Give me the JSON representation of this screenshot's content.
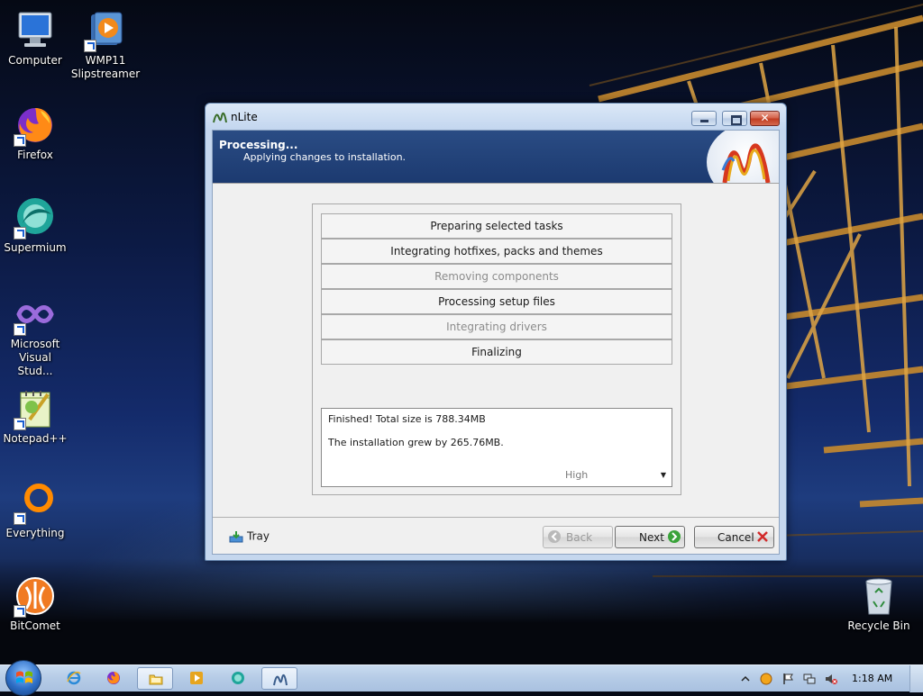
{
  "desktop": {
    "icons": [
      {
        "label": "Computer",
        "icon": "computer-icon"
      },
      {
        "label": "WMP11 Slipstreamer",
        "icon": "wmp-icon"
      },
      {
        "label": "Firefox",
        "icon": "firefox-icon"
      },
      {
        "label": "Supermium",
        "icon": "supermium-icon"
      },
      {
        "label": "Microsoft Visual Stud...",
        "icon": "visual-studio-icon"
      },
      {
        "label": "Notepad++",
        "icon": "notepadpp-icon"
      },
      {
        "label": "Everything",
        "icon": "everything-icon"
      },
      {
        "label": "BitComet",
        "icon": "bitcomet-icon"
      },
      {
        "label": "Recycle Bin",
        "icon": "recycle-bin-icon"
      }
    ]
  },
  "window": {
    "title": "nLite",
    "header": {
      "title": "Processing...",
      "subtitle": "Applying changes to installation."
    },
    "tasks": [
      {
        "label": "Preparing selected tasks",
        "state": "done"
      },
      {
        "label": "Integrating hotfixes, packs and themes",
        "state": "done"
      },
      {
        "label": "Removing components",
        "state": "skipped"
      },
      {
        "label": "Processing setup files",
        "state": "done"
      },
      {
        "label": "Integrating drivers",
        "state": "skipped"
      },
      {
        "label": "Finalizing",
        "state": "done"
      }
    ],
    "log": {
      "line1": "Finished! Total size is 788.34MB",
      "line2": "The installation grew by 265.76MB."
    },
    "priority": {
      "selected": "High"
    },
    "footer": {
      "tray_label": "Tray",
      "back_label": "Back",
      "next_label": "Next",
      "cancel_label": "Cancel"
    }
  },
  "taskbar": {
    "clock": "1:18 AM",
    "items": [
      "ie-icon",
      "firefox-icon",
      "explorer-icon",
      "wmp-icon",
      "supermium-icon",
      "nlite-icon"
    ]
  },
  "colors": {
    "header_bg": "#1c3a70",
    "next_green": "#3aa33a",
    "cancel_red": "#d22a2a"
  }
}
